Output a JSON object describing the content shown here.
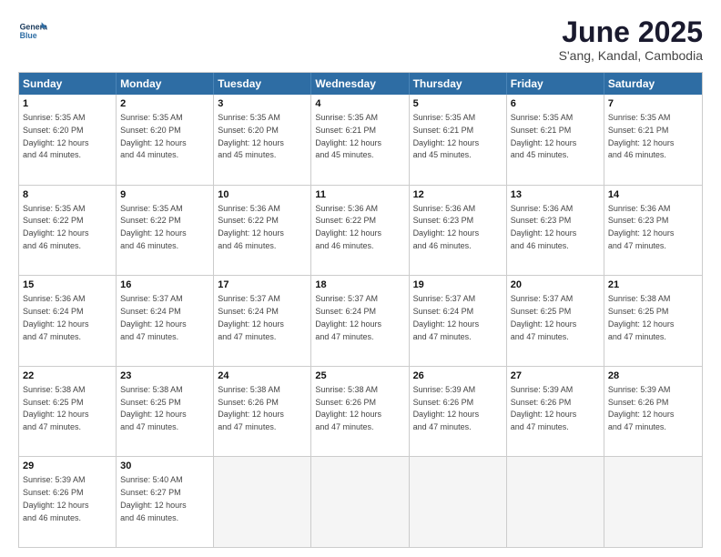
{
  "header": {
    "logo_line1": "General",
    "logo_line2": "Blue",
    "month_title": "June 2025",
    "location": "S'ang, Kandal, Cambodia"
  },
  "weekdays": [
    "Sunday",
    "Monday",
    "Tuesday",
    "Wednesday",
    "Thursday",
    "Friday",
    "Saturday"
  ],
  "weeks": [
    [
      {
        "day": "1",
        "rise": "5:35 AM",
        "set": "6:20 PM",
        "dl": "12 hours and 44 minutes."
      },
      {
        "day": "2",
        "rise": "5:35 AM",
        "set": "6:20 PM",
        "dl": "12 hours and 44 minutes."
      },
      {
        "day": "3",
        "rise": "5:35 AM",
        "set": "6:20 PM",
        "dl": "12 hours and 45 minutes."
      },
      {
        "day": "4",
        "rise": "5:35 AM",
        "set": "6:21 PM",
        "dl": "12 hours and 45 minutes."
      },
      {
        "day": "5",
        "rise": "5:35 AM",
        "set": "6:21 PM",
        "dl": "12 hours and 45 minutes."
      },
      {
        "day": "6",
        "rise": "5:35 AM",
        "set": "6:21 PM",
        "dl": "12 hours and 45 minutes."
      },
      {
        "day": "7",
        "rise": "5:35 AM",
        "set": "6:21 PM",
        "dl": "12 hours and 46 minutes."
      }
    ],
    [
      {
        "day": "8",
        "rise": "5:35 AM",
        "set": "6:22 PM",
        "dl": "12 hours and 46 minutes."
      },
      {
        "day": "9",
        "rise": "5:35 AM",
        "set": "6:22 PM",
        "dl": "12 hours and 46 minutes."
      },
      {
        "day": "10",
        "rise": "5:36 AM",
        "set": "6:22 PM",
        "dl": "12 hours and 46 minutes."
      },
      {
        "day": "11",
        "rise": "5:36 AM",
        "set": "6:22 PM",
        "dl": "12 hours and 46 minutes."
      },
      {
        "day": "12",
        "rise": "5:36 AM",
        "set": "6:23 PM",
        "dl": "12 hours and 46 minutes."
      },
      {
        "day": "13",
        "rise": "5:36 AM",
        "set": "6:23 PM",
        "dl": "12 hours and 46 minutes."
      },
      {
        "day": "14",
        "rise": "5:36 AM",
        "set": "6:23 PM",
        "dl": "12 hours and 47 minutes."
      }
    ],
    [
      {
        "day": "15",
        "rise": "5:36 AM",
        "set": "6:24 PM",
        "dl": "12 hours and 47 minutes."
      },
      {
        "day": "16",
        "rise": "5:37 AM",
        "set": "6:24 PM",
        "dl": "12 hours and 47 minutes."
      },
      {
        "day": "17",
        "rise": "5:37 AM",
        "set": "6:24 PM",
        "dl": "12 hours and 47 minutes."
      },
      {
        "day": "18",
        "rise": "5:37 AM",
        "set": "6:24 PM",
        "dl": "12 hours and 47 minutes."
      },
      {
        "day": "19",
        "rise": "5:37 AM",
        "set": "6:24 PM",
        "dl": "12 hours and 47 minutes."
      },
      {
        "day": "20",
        "rise": "5:37 AM",
        "set": "6:25 PM",
        "dl": "12 hours and 47 minutes."
      },
      {
        "day": "21",
        "rise": "5:38 AM",
        "set": "6:25 PM",
        "dl": "12 hours and 47 minutes."
      }
    ],
    [
      {
        "day": "22",
        "rise": "5:38 AM",
        "set": "6:25 PM",
        "dl": "12 hours and 47 minutes."
      },
      {
        "day": "23",
        "rise": "5:38 AM",
        "set": "6:25 PM",
        "dl": "12 hours and 47 minutes."
      },
      {
        "day": "24",
        "rise": "5:38 AM",
        "set": "6:26 PM",
        "dl": "12 hours and 47 minutes."
      },
      {
        "day": "25",
        "rise": "5:38 AM",
        "set": "6:26 PM",
        "dl": "12 hours and 47 minutes."
      },
      {
        "day": "26",
        "rise": "5:39 AM",
        "set": "6:26 PM",
        "dl": "12 hours and 47 minutes."
      },
      {
        "day": "27",
        "rise": "5:39 AM",
        "set": "6:26 PM",
        "dl": "12 hours and 47 minutes."
      },
      {
        "day": "28",
        "rise": "5:39 AM",
        "set": "6:26 PM",
        "dl": "12 hours and 47 minutes."
      }
    ],
    [
      {
        "day": "29",
        "rise": "5:39 AM",
        "set": "6:26 PM",
        "dl": "12 hours and 46 minutes."
      },
      {
        "day": "30",
        "rise": "5:40 AM",
        "set": "6:27 PM",
        "dl": "12 hours and 46 minutes."
      },
      null,
      null,
      null,
      null,
      null
    ]
  ],
  "labels": {
    "sunrise": "Sunrise:",
    "sunset": "Sunset:",
    "daylight": "Daylight:"
  }
}
